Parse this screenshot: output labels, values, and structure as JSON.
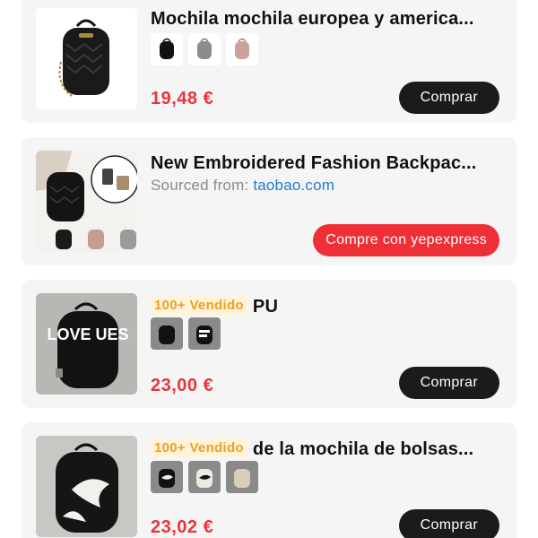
{
  "products": [
    {
      "title": "Mochila mochila europea y america...",
      "price": "19,48 €",
      "button": "Comprar",
      "swatches": [
        "black-backpack",
        "grey-backpack",
        "pink-backpack"
      ]
    },
    {
      "title": "New Embroidered Fashion Backpac...",
      "sourced_label": "Sourced from:",
      "sourced_link": "taobao.com",
      "button": "Compre con yepexpress"
    },
    {
      "sold_badge": "100+ Vendido",
      "title": "PU",
      "price": "23,00 €",
      "button": "Comprar",
      "thumb_text": "LOVE UES",
      "swatches": [
        "black-backpack",
        "black-love-backpack"
      ]
    },
    {
      "sold_badge": "100+ Vendido",
      "title": "de la mochila de bolsas...",
      "price": "23,02 €",
      "button": "Comprar",
      "swatches": [
        "black-white-backpack",
        "white-black-backpack",
        "beige-backpack"
      ]
    }
  ],
  "colors": {
    "price": "#e8343a",
    "button_dark": "#1b1b1b",
    "button_red": "#ee2f36",
    "sold_text": "#f0a020",
    "sold_bg": "#fff3d9",
    "link": "#1f7bd1"
  }
}
